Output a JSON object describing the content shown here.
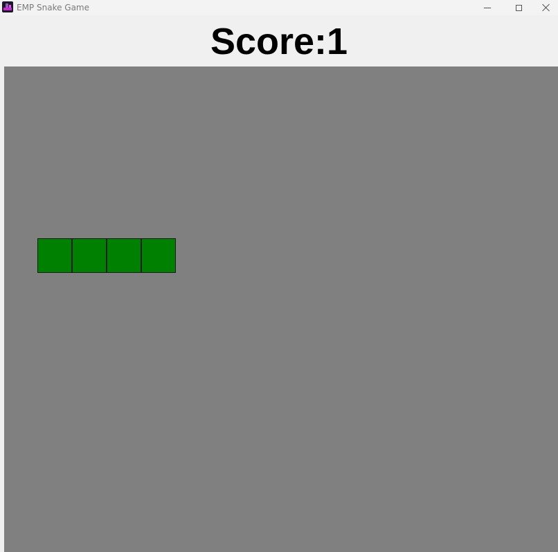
{
  "window": {
    "title": "EMP Snake Game",
    "icon": "snake-game-app-icon",
    "controls": [
      "minimize-icon",
      "maximize-icon",
      "close-icon"
    ]
  },
  "header": {
    "score_text": "Score:1"
  },
  "game": {
    "board_color": "#808080",
    "snake_color": "#008000",
    "snake_length": 4
  }
}
